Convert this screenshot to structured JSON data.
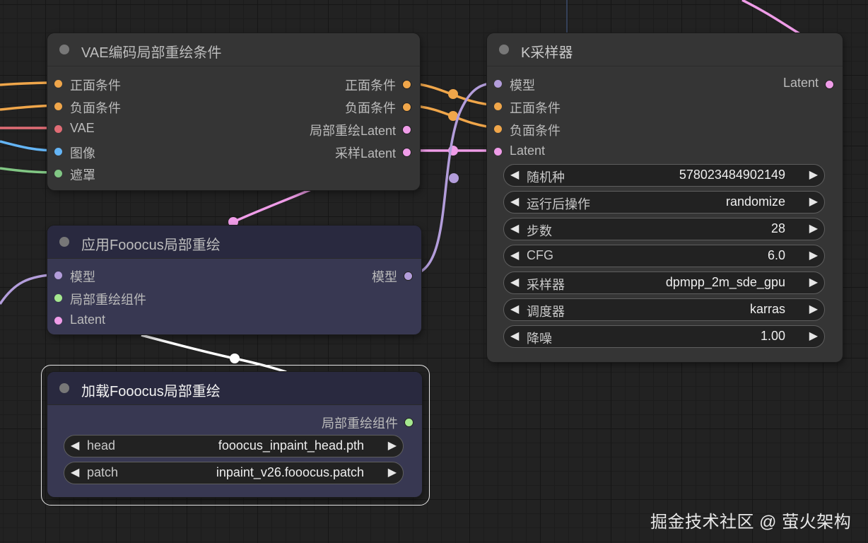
{
  "nodes": {
    "vae_encode": {
      "title": "VAE编码局部重绘条件",
      "inputs": [
        "正面条件",
        "负面条件",
        "VAE",
        "图像",
        "遮罩"
      ],
      "outputs": [
        "正面条件",
        "负面条件",
        "局部重绘Latent",
        "采样Latent"
      ]
    },
    "apply_fooocus": {
      "title": "应用Fooocus局部重绘",
      "inputs": [
        "模型",
        "局部重绘组件",
        "Latent"
      ],
      "outputs": [
        "模型"
      ]
    },
    "load_fooocus": {
      "title": "加载Fooocus局部重绘",
      "outputs": [
        "局部重绘组件"
      ],
      "widgets": [
        {
          "name": "head",
          "value": "fooocus_inpaint_head.pth"
        },
        {
          "name": "patch",
          "value": "inpaint_v26.fooocus.patch"
        }
      ]
    },
    "ksampler": {
      "title": "K采样器",
      "inputs": [
        "模型",
        "正面条件",
        "负面条件",
        "Latent"
      ],
      "outputs": [
        "Latent"
      ],
      "widgets": [
        {
          "name": "随机种",
          "value": "578023484902149"
        },
        {
          "name": "运行后操作",
          "value": "randomize"
        },
        {
          "name": "步数",
          "value": "28"
        },
        {
          "name": "CFG",
          "value": "6.0"
        },
        {
          "name": "采样器",
          "value": "dpmpp_2m_sde_gpu"
        },
        {
          "name": "调度器",
          "value": "karras"
        },
        {
          "name": "降噪",
          "value": "1.00"
        }
      ]
    }
  },
  "widget_arrows": {
    "left": "◀",
    "right": "▶"
  },
  "watermark": "掘金技术社区 @ 萤火架构",
  "colors": {
    "conditioning": "#f0a64a",
    "vae": "#e06c75",
    "image": "#64b5f6",
    "mask": "#81c784",
    "latent": "#ef9ce8",
    "model": "#b39ddb",
    "inpaint_patch": "#a5e88f",
    "link_white": "#ffffff"
  }
}
